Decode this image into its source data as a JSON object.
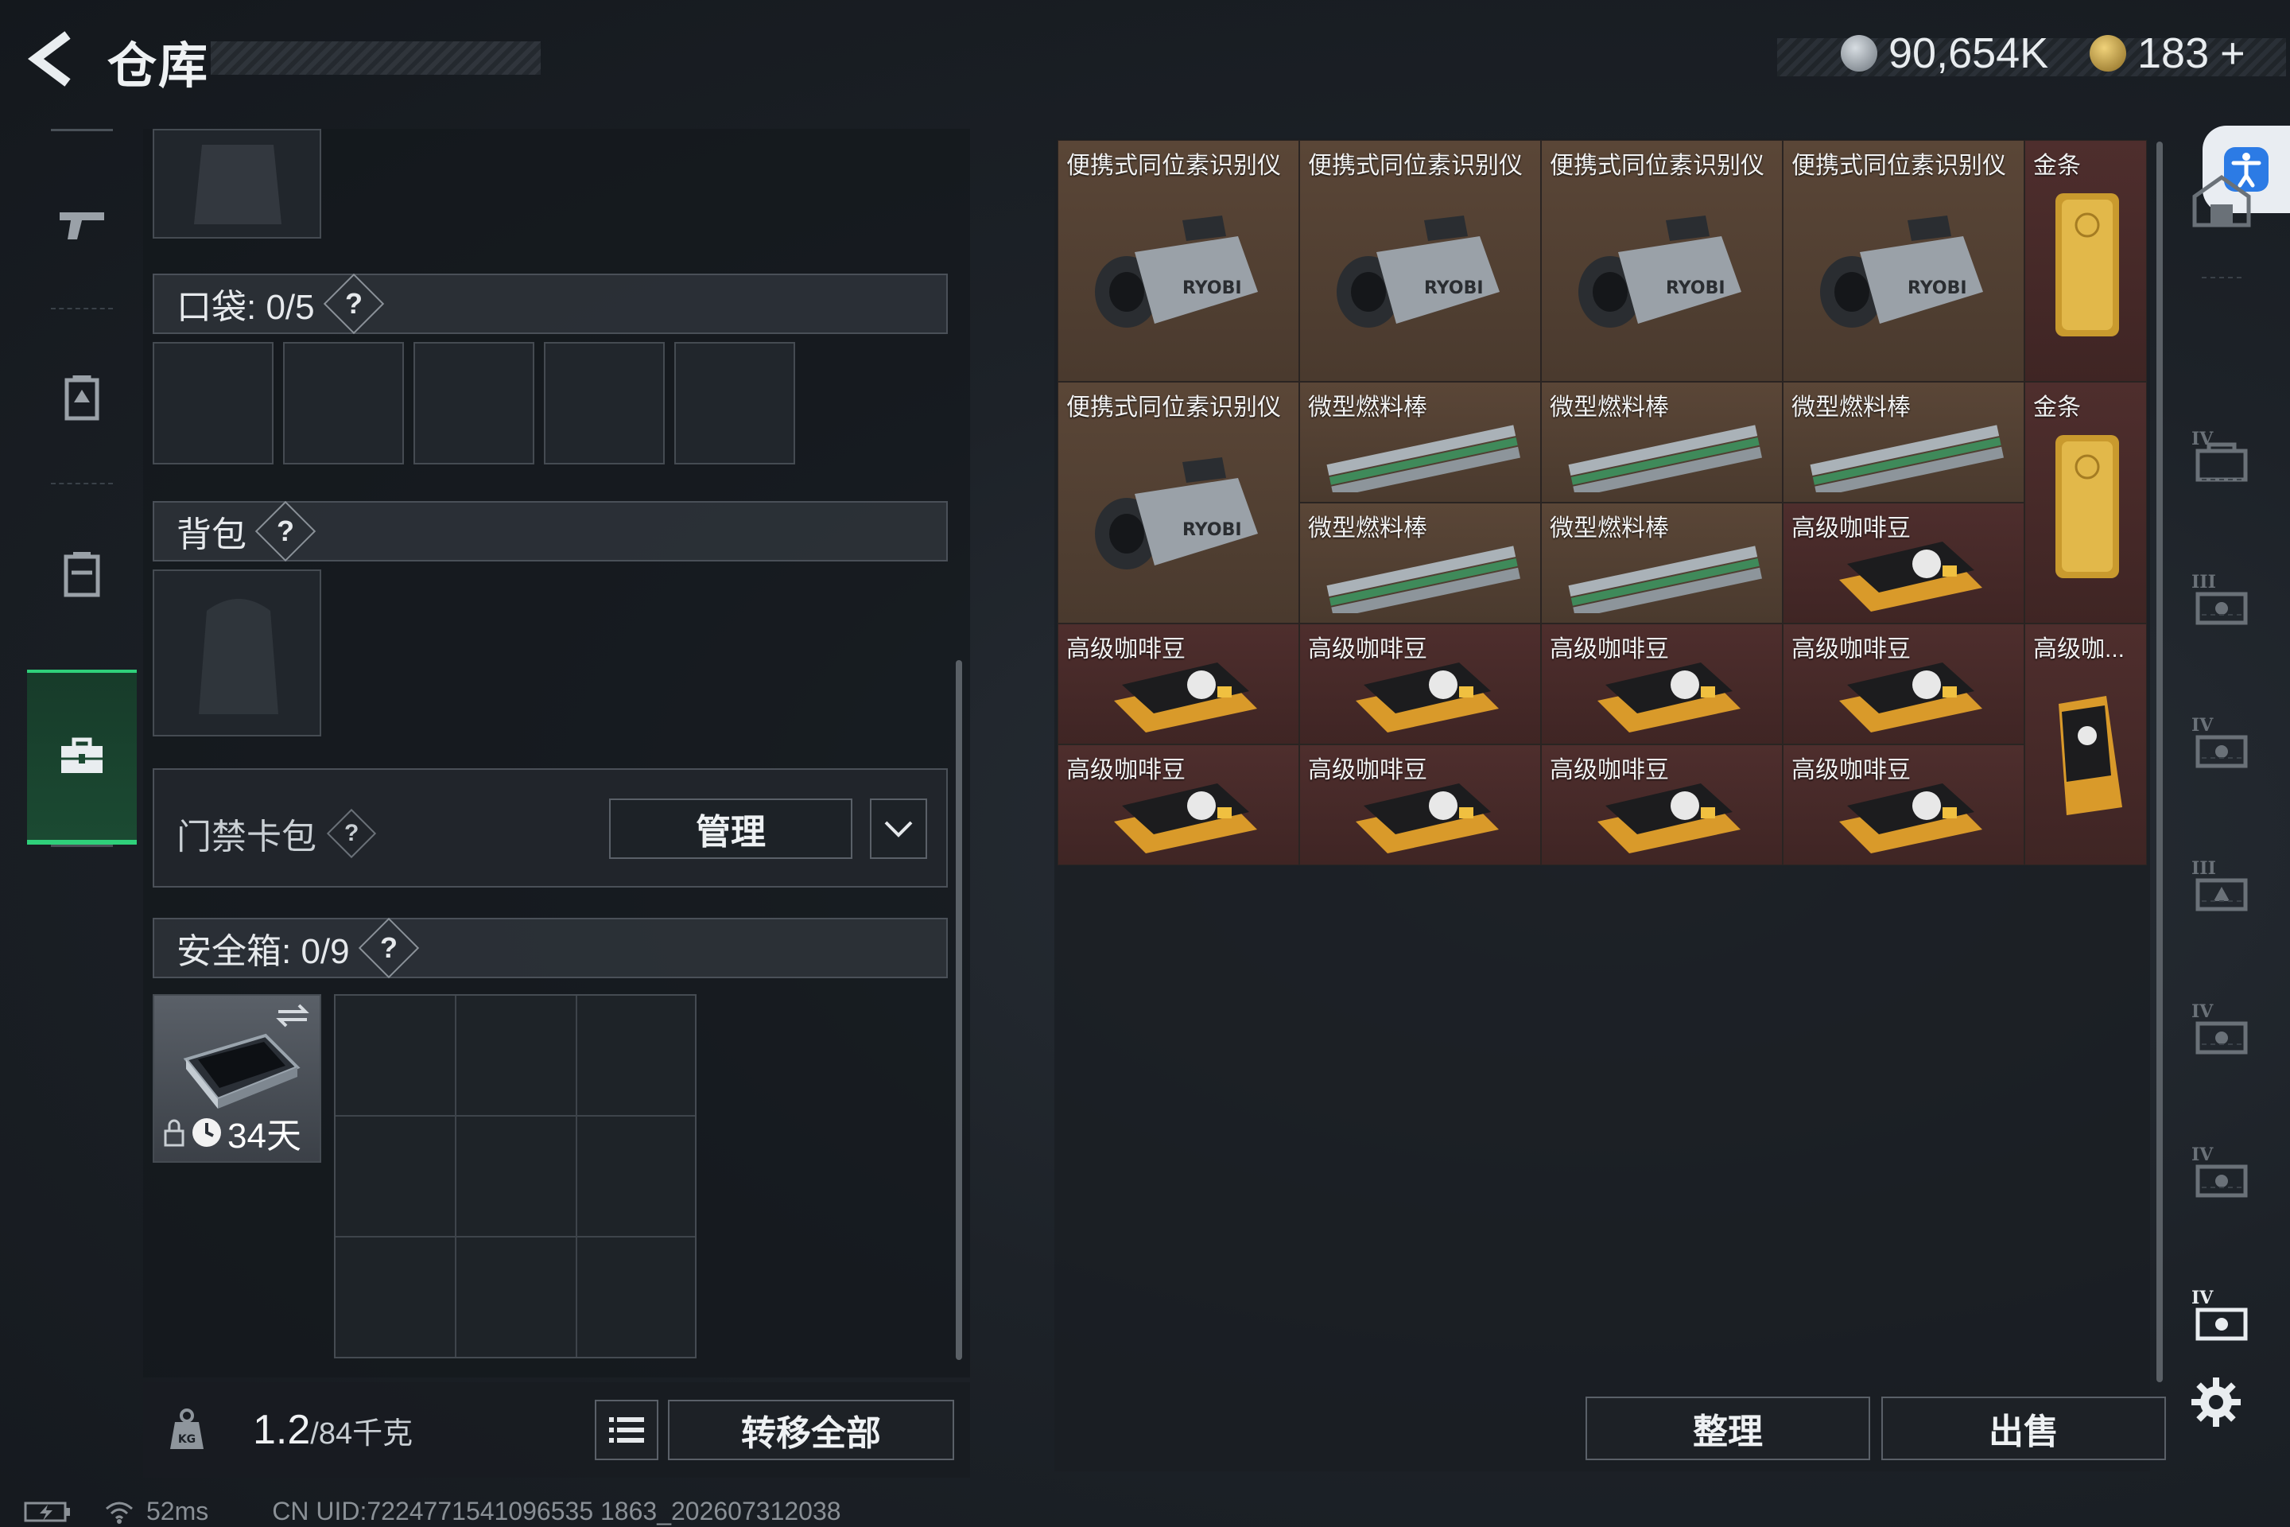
{
  "header": {
    "title": "仓库",
    "currency_a": "90,654K",
    "currency_b": "183",
    "currency_b_plus": "+"
  },
  "left": {
    "pocket_label": "口袋: 0/5",
    "backpack_label": "背包",
    "keycard_label": "门禁卡包",
    "manage_label": "管理",
    "safe_label": "安全箱: 0/9",
    "safe_timer": "34天",
    "weight_value": "1.2",
    "weight_cap": "/84千克",
    "transfer_all": "转移全部"
  },
  "right": {
    "sort_label": "整理",
    "sell_label": "出售"
  },
  "items": {
    "iso": "便携式同位素识别仪",
    "gold": "金条",
    "fuel": "微型燃料棒",
    "coffee": "高级咖啡豆",
    "coffee_short": "高级咖..."
  },
  "status": {
    "ping": "52ms",
    "uid": "CN UID:7224771541096535 1863_202607312038"
  },
  "colors": {
    "accent": "#2fd07a",
    "rare_brown": "#5a4637",
    "rare_red": "#4e2e2d"
  }
}
